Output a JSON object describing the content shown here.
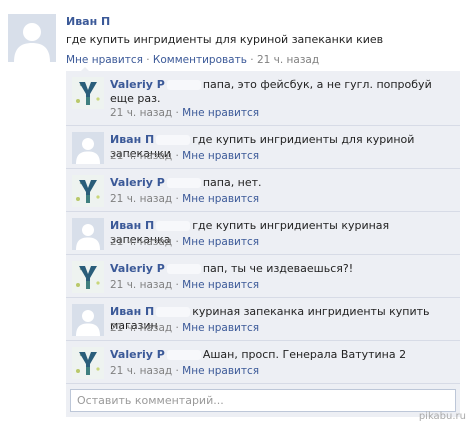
{
  "post": {
    "author": "Иван П",
    "text": "где купить ингридиенты для куриной запеканки киев",
    "like_label": "Мне нравится",
    "sep": " · ",
    "comment_label": "Комментировать",
    "time": "21 ч. назад"
  },
  "comments": [
    {
      "author": "Valeriy P",
      "avatar": "logo-y",
      "text": "папа, это фейсбук, а не гугл. попробуй еще раз.",
      "time": "21 ч. назад",
      "like": "Мне нравится"
    },
    {
      "author": "Иван П",
      "avatar": "silhouette",
      "text": "где купить ингридиенты для куриной запеканки",
      "time": "21 ч. назад",
      "like": "Мне нравится"
    },
    {
      "author": "Valeriy P",
      "avatar": "logo-y",
      "text": "папа, нет.",
      "time": "21 ч. назад",
      "like": "Мне нравится"
    },
    {
      "author": "Иван П",
      "avatar": "silhouette",
      "text": "где купить ингридиенты куриная запеканка",
      "time": "21 ч. назад",
      "like": "Мне нравится"
    },
    {
      "author": "Valeriy P",
      "avatar": "logo-y",
      "text": "пап, ты че издеваешься?!",
      "time": "21 ч. назад",
      "like": "Мне нравится"
    },
    {
      "author": "Иван П",
      "avatar": "silhouette",
      "text": "куриная запеканка ингридиенты купить магазин",
      "time": "21 ч. назад",
      "like": "Мне нравится"
    },
    {
      "author": "Valeriy P",
      "avatar": "logo-y",
      "text": "Ашан,  просп. Генерала Ватутина 2",
      "time": "21 ч. назад",
      "like": "Мне нравится"
    }
  ],
  "comment_box": {
    "placeholder": "Оставить комментарий..."
  },
  "watermark": "pikabu.ru",
  "colors": {
    "link": "#3b5998",
    "comment_bg": "#edeff4",
    "meta": "#808080"
  }
}
